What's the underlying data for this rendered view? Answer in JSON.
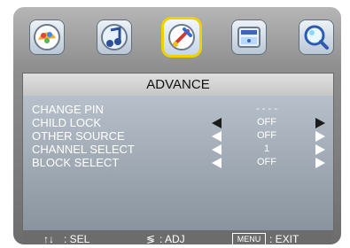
{
  "header": {
    "title": "ADVANCE"
  },
  "icons": [
    "picture-icon",
    "sound-icon",
    "advance-icon",
    "clock-icon",
    "search-icon"
  ],
  "menu": {
    "change_pin": {
      "label": "CHANGE PIN",
      "value": "- - - -"
    },
    "child_lock": {
      "label": "CHILD LOCK",
      "value": "OFF"
    },
    "other_source": {
      "label": "OTHER SOURCE",
      "value": "OFF"
    },
    "channel_select": {
      "label": "CHANNEL SELECT",
      "value": "1"
    },
    "block_select": {
      "label": "BLOCK SELECT",
      "value": "OFF"
    }
  },
  "footer": {
    "sel_symbol": "↑↓",
    "sel_text": ": SEL",
    "adj_symbol": "≶",
    "adj_text": ": ADJ",
    "menu_key": "MENU",
    "exit_text": ": EXIT"
  },
  "colors": {
    "selected_border": "#f0d200",
    "panel_text": "#ffffff",
    "arrow_selected": "#1c1c1c"
  }
}
